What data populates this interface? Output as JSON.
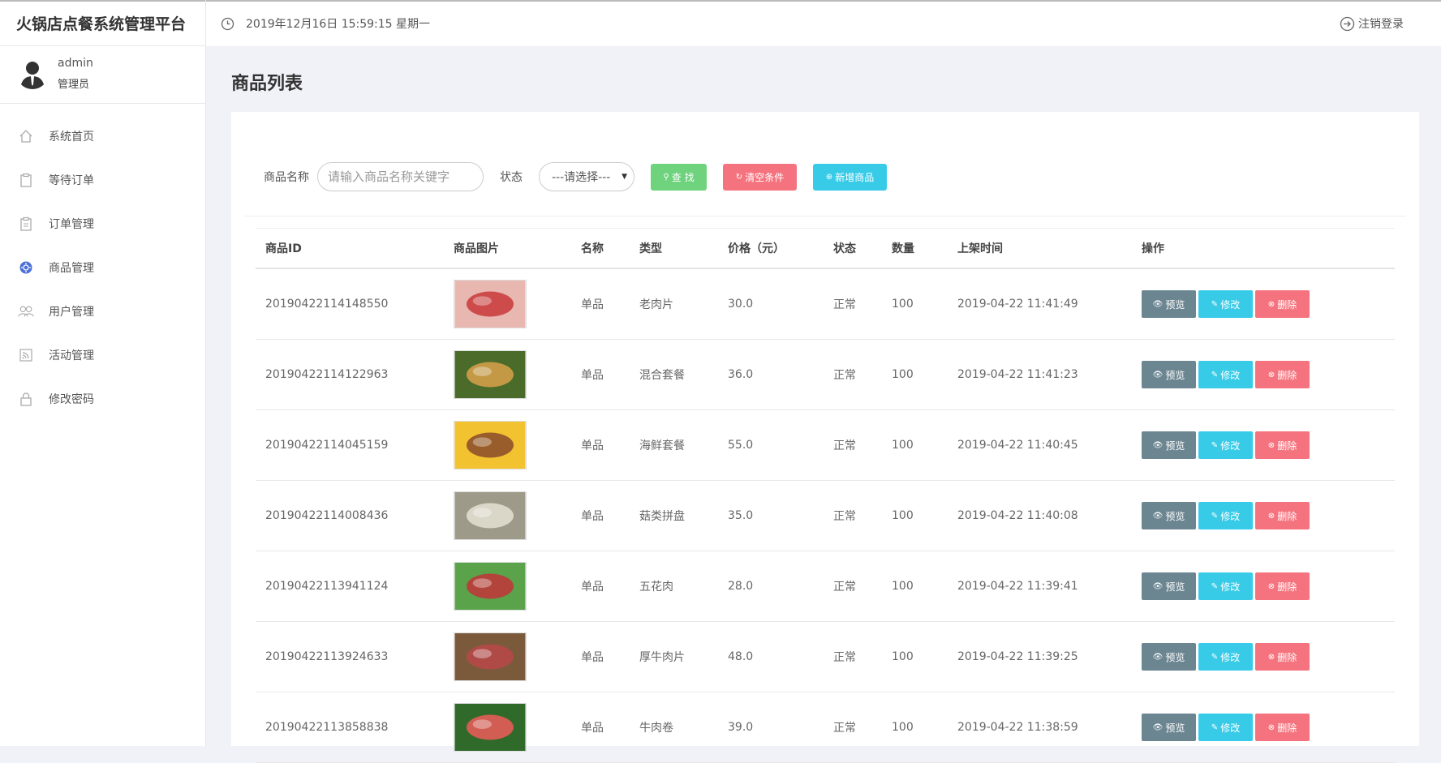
{
  "app": {
    "title": "火锅店点餐系统管理平台"
  },
  "user": {
    "name": "admin",
    "role": "管理员"
  },
  "sidebar": {
    "items": [
      {
        "label": "系统首页",
        "icon": "home-icon"
      },
      {
        "label": "等待订单",
        "icon": "clipboard-icon"
      },
      {
        "label": "订单管理",
        "icon": "clipboard-list-icon"
      },
      {
        "label": "商品管理",
        "icon": "product-icon"
      },
      {
        "label": "用户管理",
        "icon": "users-icon"
      },
      {
        "label": "活动管理",
        "icon": "rss-icon"
      },
      {
        "label": "修改密码",
        "icon": "lock-icon"
      }
    ]
  },
  "topbar": {
    "datetime": "2019年12月16日 15:59:15 星期一",
    "logout": "注销登录"
  },
  "page": {
    "title": "商品列表"
  },
  "filter": {
    "name_label": "商品名称",
    "name_placeholder": "请输入商品名称关键字",
    "status_label": "状态",
    "status_value": "---请选择---",
    "search_btn": "查 找",
    "clear_btn": "清空条件",
    "add_btn": "新增商品"
  },
  "table": {
    "headers": [
      "商品ID",
      "商品图片",
      "名称",
      "类型",
      "价格（元）",
      "状态",
      "数量",
      "上架时间",
      "操作"
    ],
    "actions": {
      "preview": "预览",
      "edit": "修改",
      "delete": "删除"
    },
    "rows": [
      {
        "id": "20190422114148550",
        "name": "单品",
        "type": "老肉片",
        "price": "30.0",
        "status": "正常",
        "qty": "100",
        "time": "2019-04-22 11:41:49",
        "img_bg": "#e8b7b0",
        "img_fg": "#c83a3a"
      },
      {
        "id": "20190422114122963",
        "name": "单品",
        "type": "混合套餐",
        "price": "36.0",
        "status": "正常",
        "qty": "100",
        "time": "2019-04-22 11:41:23",
        "img_bg": "#4a6b2a",
        "img_fg": "#d9a14a"
      },
      {
        "id": "20190422114045159",
        "name": "单品",
        "type": "海鲜套餐",
        "price": "55.0",
        "status": "正常",
        "qty": "100",
        "time": "2019-04-22 11:40:45",
        "img_bg": "#f2c230",
        "img_fg": "#8a4a2a"
      },
      {
        "id": "20190422114008436",
        "name": "单品",
        "type": "菇类拼盘",
        "price": "35.0",
        "status": "正常",
        "qty": "100",
        "time": "2019-04-22 11:40:08",
        "img_bg": "#9d9a8a",
        "img_fg": "#e6e2d2"
      },
      {
        "id": "20190422113941124",
        "name": "单品",
        "type": "五花肉",
        "price": "28.0",
        "status": "正常",
        "qty": "100",
        "time": "2019-04-22 11:39:41",
        "img_bg": "#5aa34a",
        "img_fg": "#c2343a"
      },
      {
        "id": "20190422113924633",
        "name": "单品",
        "type": "厚牛肉片",
        "price": "48.0",
        "status": "正常",
        "qty": "100",
        "time": "2019-04-22 11:39:25",
        "img_bg": "#7a5a3a",
        "img_fg": "#b8484a"
      },
      {
        "id": "20190422113858838",
        "name": "单品",
        "type": "牛肉卷",
        "price": "39.0",
        "status": "正常",
        "qty": "100",
        "time": "2019-04-22 11:38:59",
        "img_bg": "#2f6a2a",
        "img_fg": "#ef5a5a"
      }
    ]
  }
}
